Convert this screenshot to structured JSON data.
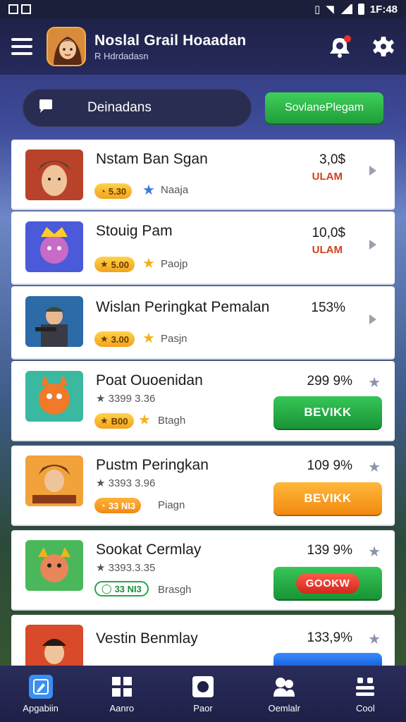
{
  "status_bar": {
    "time": "1F:48"
  },
  "header": {
    "title": "Noslal Grail Hoaadan",
    "subtitle": "R Hdrdadasn"
  },
  "search": {
    "placeholder": "Deinadans",
    "button_label": "SovlanePlegam"
  },
  "rows": [
    {
      "title": "Nstam Ban Sgan",
      "badge": "5.30",
      "tag": "Naaja",
      "value": "3,0$",
      "sub_value": "ULAM",
      "action": "chevron"
    },
    {
      "title": "Stouig Pam",
      "badge": "5.00",
      "tag": "Paojp",
      "value": "10,0$",
      "sub_value": "ULAM",
      "action": "chevron"
    },
    {
      "title": "Wislan Peringkat Pemalan",
      "badge": "3.00",
      "tag": "Pasjn",
      "value": "153%",
      "sub_value": "",
      "action": "chevron"
    },
    {
      "title": "Poat Ouoenidan",
      "subline": "3399 3.36",
      "badge": "B00",
      "tag": "Btagh",
      "value": "299 9%",
      "button": "BEVIKK",
      "button_style": "green"
    },
    {
      "title": "Pustm Peringkan",
      "subline": "3393 3.96",
      "badge": "33 NI3",
      "tag": "Piagn",
      "value": "109 9%",
      "button": "BEVIKK",
      "button_style": "orange"
    },
    {
      "title": "Sookat Cermlay",
      "subline": "3393.3.35",
      "badge": "33 NI3",
      "tag": "Brasgh",
      "value": "139 9%",
      "button": "GOOKW",
      "button_style": "green2"
    },
    {
      "title": "Vestin Benmlay",
      "badge": "",
      "tag": "",
      "value": "133,9%",
      "button": "",
      "button_style": "blue"
    }
  ],
  "nav": [
    {
      "label": "Apgabiin",
      "icon": "edit-icon"
    },
    {
      "label": "Aanro",
      "icon": "grid-icon"
    },
    {
      "label": "Paor",
      "icon": "circle-icon"
    },
    {
      "label": "Oemlalr",
      "icon": "people-icon"
    },
    {
      "label": "Cool",
      "icon": "menu-icon"
    }
  ],
  "colors": {
    "header_bg": "#262a5c",
    "primary_green": "#1f9e3a",
    "accent_orange": "#f28a10",
    "value_red": "#d2401a"
  }
}
